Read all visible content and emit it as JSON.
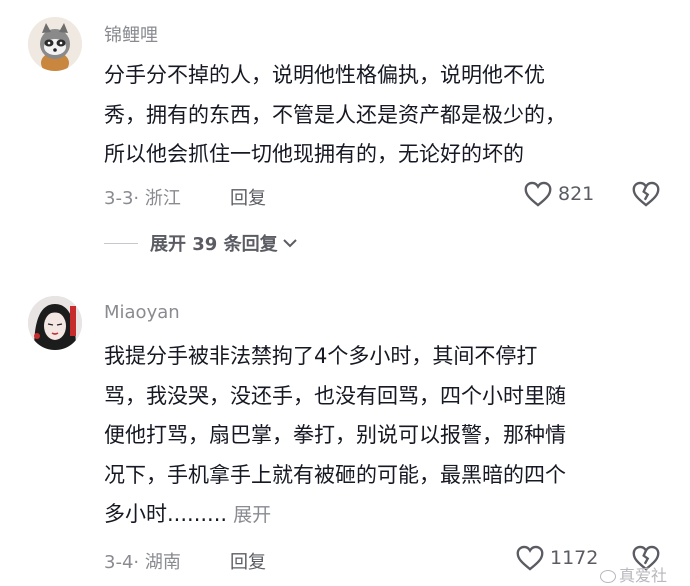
{
  "comments": [
    {
      "username": "锦鲤哩",
      "lines": [
        "分手分不掉的人，说明他性格偏执，说明他不优",
        "秀，拥有的东西，不管是人还是资产都是极少的，",
        "所以他会抓住一切他现拥有的，无论好的坏的"
      ],
      "date_location": "3-3· 浙江",
      "reply_label": "回复",
      "likes": "821",
      "expand_replies": "展开 39 条回复"
    },
    {
      "username": "Miaoyan",
      "lines": [
        "我提分手被非法禁拘了4个多小时，其间不停打",
        "骂，我没哭，没还手，也没有回骂，四个小时里随",
        "便他打骂，扇巴掌，拳打，别说可以报警，那种情",
        "况下，手机拿手上就有被砸的可能，最黑暗的四个",
        "多小时........."
      ],
      "inline_expand": "展开",
      "date_location": "3-4· 湖南",
      "reply_label": "回复",
      "likes": "1172"
    }
  ],
  "watermark": "真爱社",
  "colors": {
    "text": "#161823",
    "meta": "#8a8b91",
    "icon": "#5b5c63"
  }
}
